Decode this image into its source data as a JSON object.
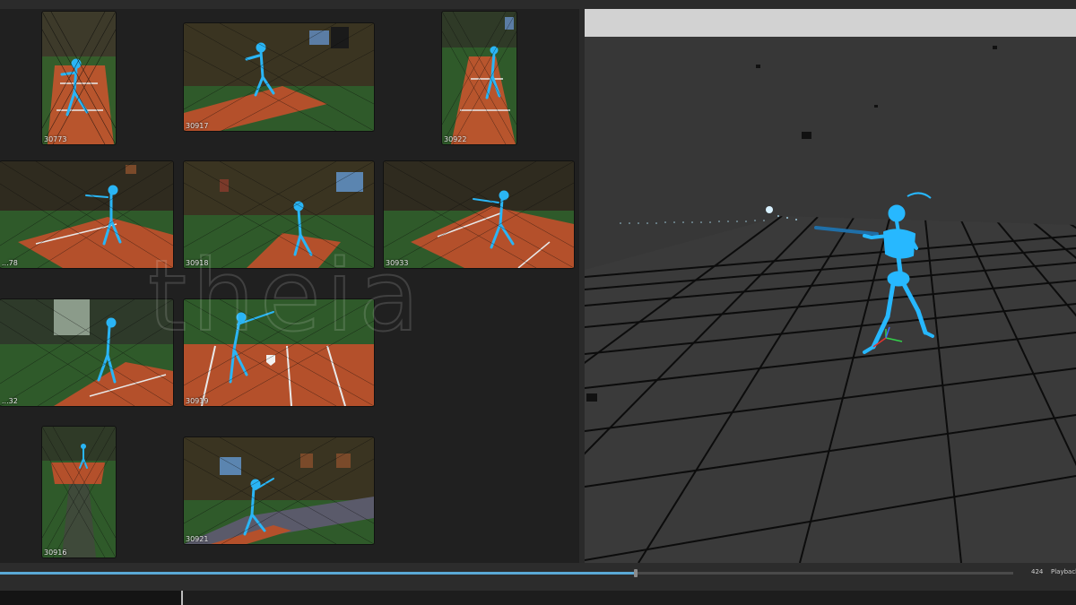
{
  "cameras": [
    {
      "id": "30773"
    },
    {
      "id": "30917"
    },
    {
      "id": "30922"
    },
    {
      "id": "...78"
    },
    {
      "id": "30918"
    },
    {
      "id": "30933"
    },
    {
      "id": "...32"
    },
    {
      "id": "30919"
    },
    {
      "id": "30916"
    },
    {
      "id": "30921"
    }
  ],
  "watermark": {
    "text": "theia"
  },
  "timeline": {
    "frame": "424",
    "playback_label": "Playback:",
    "progress": 0.627
  },
  "colors": {
    "accent": "#5aa9d6",
    "skeleton": "#27b8ff",
    "turf": "#2f5a2a",
    "clay": "#b4502b"
  }
}
